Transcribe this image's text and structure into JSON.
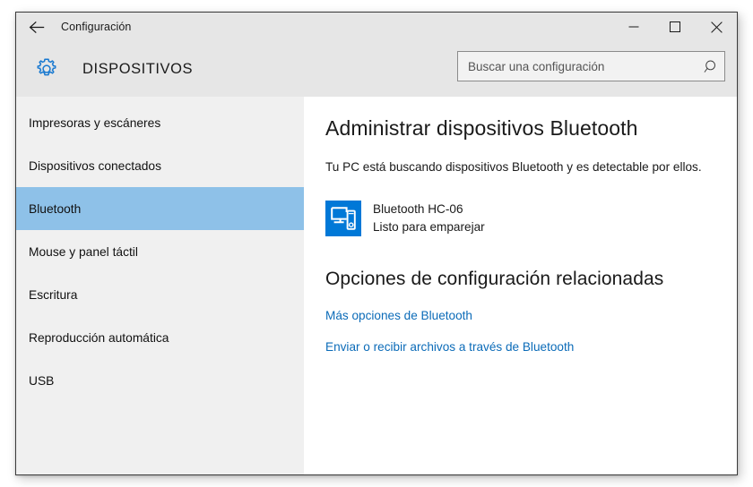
{
  "window": {
    "title": "Configuración",
    "back_icon": "back-arrow-icon",
    "controls": {
      "minimize": "minimize-icon",
      "maximize": "maximize-icon",
      "close": "close-icon"
    }
  },
  "header": {
    "app_title": "DISPOSITIVOS",
    "gear_icon": "gear-icon",
    "accent_color": "#0078d7"
  },
  "search": {
    "placeholder": "Buscar una configuración",
    "value": "",
    "icon": "search-icon"
  },
  "sidebar": {
    "selected_index": 2,
    "highlight_color": "#8ec1e8",
    "items": [
      {
        "label": "Impresoras y escáneres"
      },
      {
        "label": "Dispositivos conectados"
      },
      {
        "label": "Bluetooth"
      },
      {
        "label": "Mouse y panel táctil"
      },
      {
        "label": "Escritura"
      },
      {
        "label": "Reproducción automática"
      },
      {
        "label": "USB"
      }
    ]
  },
  "main": {
    "heading": "Administrar dispositivos Bluetooth",
    "description": "Tu PC está buscando dispositivos Bluetooth y es detectable por ellos.",
    "devices": [
      {
        "name": "Bluetooth HC-06",
        "status": "Listo para emparejar",
        "icon": "bluetooth-device-icon",
        "icon_color": "#0078d7"
      }
    ],
    "related": {
      "heading": "Opciones de configuración relacionadas",
      "link_color": "#0b6bb8",
      "links": [
        {
          "label": "Más opciones de Bluetooth"
        },
        {
          "label": "Enviar o recibir archivos a través de Bluetooth"
        }
      ]
    }
  }
}
